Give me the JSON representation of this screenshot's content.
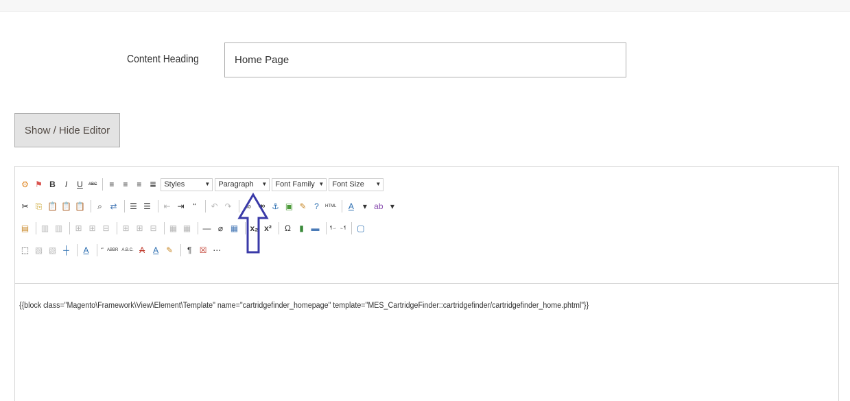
{
  "content_heading": {
    "label": "Content Heading",
    "value": "Home Page"
  },
  "editor_toggle": {
    "label": "Show / Hide Editor"
  },
  "toolbar": {
    "row1": [
      {
        "type": "icon",
        "name": "magento-widget-icon",
        "glyph": "⚙",
        "color": "#e08a2b"
      },
      {
        "type": "icon",
        "name": "magento-variable-icon",
        "glyph": "⚑",
        "color": "#d9534f"
      },
      {
        "type": "icon",
        "name": "bold-icon",
        "glyph": "B",
        "bold": true
      },
      {
        "type": "icon",
        "name": "italic-icon",
        "glyph": "I",
        "italic": true
      },
      {
        "type": "icon",
        "name": "underline-icon",
        "glyph": "U",
        "underline": true
      },
      {
        "type": "icon",
        "name": "strikethrough-icon",
        "glyph": "ABC",
        "small": true,
        "strike": true
      },
      {
        "type": "sep"
      },
      {
        "type": "icon",
        "name": "align-left-icon",
        "glyph": "≡"
      },
      {
        "type": "icon",
        "name": "align-center-icon",
        "glyph": "≡"
      },
      {
        "type": "icon",
        "name": "align-right-icon",
        "glyph": "≡"
      },
      {
        "type": "icon",
        "name": "align-justify-icon",
        "glyph": "≣"
      },
      {
        "type": "dropdown",
        "name": "styles-dropdown",
        "label": "Styles",
        "width": 76
      },
      {
        "type": "dropdown",
        "name": "paragraph-dropdown",
        "label": "Paragraph",
        "width": 80
      },
      {
        "type": "dropdown",
        "name": "font-family-dropdown",
        "label": "Font Family",
        "width": 80
      },
      {
        "type": "dropdown",
        "name": "font-size-dropdown",
        "label": "Font Size",
        "width": 80
      }
    ],
    "row2": [
      {
        "type": "icon",
        "name": "cut-icon",
        "glyph": "✂"
      },
      {
        "type": "icon",
        "name": "copy-icon",
        "glyph": "⎘",
        "color": "#c9a227"
      },
      {
        "type": "icon",
        "name": "paste-icon",
        "glyph": "📋"
      },
      {
        "type": "icon",
        "name": "paste-text-icon",
        "glyph": "📋"
      },
      {
        "type": "icon",
        "name": "paste-word-icon",
        "glyph": "📋"
      },
      {
        "type": "sep"
      },
      {
        "type": "icon",
        "name": "find-icon",
        "glyph": "⌕"
      },
      {
        "type": "icon",
        "name": "replace-icon",
        "glyph": "⇄",
        "color": "#4a7bb7"
      },
      {
        "type": "sep"
      },
      {
        "type": "icon",
        "name": "bullet-list-icon",
        "glyph": "☰"
      },
      {
        "type": "icon",
        "name": "numbered-list-icon",
        "glyph": "☰"
      },
      {
        "type": "sep"
      },
      {
        "type": "icon",
        "name": "outdent-icon",
        "glyph": "⇤",
        "dim": true
      },
      {
        "type": "icon",
        "name": "indent-icon",
        "glyph": "⇥"
      },
      {
        "type": "icon",
        "name": "blockquote-icon",
        "glyph": "“"
      },
      {
        "type": "sep"
      },
      {
        "type": "icon",
        "name": "undo-icon",
        "glyph": "↶",
        "dim": true
      },
      {
        "type": "icon",
        "name": "redo-icon",
        "glyph": "↷",
        "dim": true
      },
      {
        "type": "sep"
      },
      {
        "type": "icon",
        "name": "link-icon",
        "glyph": "∞"
      },
      {
        "type": "icon",
        "name": "unlink-icon",
        "glyph": "⚮"
      },
      {
        "type": "icon",
        "name": "anchor-icon",
        "glyph": "⚓",
        "color": "#2a6db0"
      },
      {
        "type": "icon",
        "name": "image-icon",
        "glyph": "▣",
        "color": "#4c9a3a"
      },
      {
        "type": "icon",
        "name": "cleanup-icon",
        "glyph": "✎",
        "color": "#c98a2b"
      },
      {
        "type": "icon",
        "name": "help-icon",
        "glyph": "?",
        "color": "#2a6db0"
      },
      {
        "type": "icon",
        "name": "html-source-icon",
        "glyph": "HTML",
        "small": true
      },
      {
        "type": "sep"
      },
      {
        "type": "icon",
        "name": "text-color-icon",
        "glyph": "A",
        "underline": true,
        "color": "#2a6db0"
      },
      {
        "type": "icon",
        "name": "text-color-dropdown-icon",
        "glyph": "▾"
      },
      {
        "type": "icon",
        "name": "background-color-icon",
        "glyph": "ab",
        "color": "#8a4fb0"
      },
      {
        "type": "icon",
        "name": "background-color-dropdown-icon",
        "glyph": "▾"
      }
    ],
    "row3": [
      {
        "type": "icon",
        "name": "table-insert-icon",
        "glyph": "▤",
        "color": "#c98a2b"
      },
      {
        "type": "sep"
      },
      {
        "type": "icon",
        "name": "row-props-icon",
        "glyph": "▥",
        "dim": true
      },
      {
        "type": "icon",
        "name": "cell-props-icon",
        "glyph": "▥",
        "dim": true
      },
      {
        "type": "sep"
      },
      {
        "type": "icon",
        "name": "insert-row-before-icon",
        "glyph": "⊞",
        "dim": true
      },
      {
        "type": "icon",
        "name": "insert-row-after-icon",
        "glyph": "⊞",
        "dim": true
      },
      {
        "type": "icon",
        "name": "delete-row-icon",
        "glyph": "⊟",
        "dim": true
      },
      {
        "type": "sep"
      },
      {
        "type": "icon",
        "name": "insert-col-before-icon",
        "glyph": "⊞",
        "dim": true
      },
      {
        "type": "icon",
        "name": "insert-col-after-icon",
        "glyph": "⊞",
        "dim": true
      },
      {
        "type": "icon",
        "name": "delete-col-icon",
        "glyph": "⊟",
        "dim": true
      },
      {
        "type": "sep"
      },
      {
        "type": "icon",
        "name": "split-cells-icon",
        "glyph": "▦",
        "dim": true
      },
      {
        "type": "icon",
        "name": "merge-cells-icon",
        "glyph": "▦",
        "dim": true
      },
      {
        "type": "sep"
      },
      {
        "type": "icon",
        "name": "horizontal-rule-icon",
        "glyph": "—"
      },
      {
        "type": "icon",
        "name": "remove-format-icon",
        "glyph": "⌀"
      },
      {
        "type": "icon",
        "name": "visual-aid-icon",
        "glyph": "▦",
        "color": "#4a7bb7"
      },
      {
        "type": "sep"
      },
      {
        "type": "icon",
        "name": "subscript-icon",
        "glyph": "x₂",
        "bold": true
      },
      {
        "type": "icon",
        "name": "superscript-icon",
        "glyph": "x²",
        "bold": true
      },
      {
        "type": "sep"
      },
      {
        "type": "icon",
        "name": "special-char-icon",
        "glyph": "Ω"
      },
      {
        "type": "icon",
        "name": "media-icon",
        "glyph": "▮",
        "color": "#3a8a3a"
      },
      {
        "type": "icon",
        "name": "separator-icon",
        "glyph": "▬",
        "color": "#4a7bb7"
      },
      {
        "type": "sep"
      },
      {
        "type": "icon",
        "name": "ltr-icon",
        "glyph": "¶→",
        "small": true
      },
      {
        "type": "icon",
        "name": "rtl-icon",
        "glyph": "←¶",
        "small": true
      },
      {
        "type": "sep"
      },
      {
        "type": "icon",
        "name": "fullscreen-icon",
        "glyph": "▢",
        "color": "#2a6db0"
      }
    ],
    "row4": [
      {
        "type": "icon",
        "name": "insert-layer-icon",
        "glyph": "⬚"
      },
      {
        "type": "icon",
        "name": "move-forward-icon",
        "glyph": "▧",
        "dim": true
      },
      {
        "type": "icon",
        "name": "move-backward-icon",
        "glyph": "▧",
        "dim": true
      },
      {
        "type": "icon",
        "name": "absolute-icon",
        "glyph": "┼",
        "color": "#2a6db0"
      },
      {
        "type": "sep"
      },
      {
        "type": "icon",
        "name": "style-props-icon",
        "glyph": "A",
        "underline": true,
        "color": "#2a6db0"
      },
      {
        "type": "sep"
      },
      {
        "type": "icon",
        "name": "cite-icon",
        "glyph": "“”",
        "small": true
      },
      {
        "type": "icon",
        "name": "abbreviation-icon",
        "glyph": "ABBR",
        "small": true
      },
      {
        "type": "icon",
        "name": "acronym-icon",
        "glyph": "A.B.C.",
        "small": true
      },
      {
        "type": "icon",
        "name": "deletion-icon",
        "glyph": "A",
        "strike": true,
        "color": "#c0392b"
      },
      {
        "type": "icon",
        "name": "insertion-icon",
        "glyph": "A",
        "underline": true,
        "color": "#2a6db0"
      },
      {
        "type": "icon",
        "name": "attributes-icon",
        "glyph": "✎",
        "color": "#c98a2b"
      },
      {
        "type": "sep"
      },
      {
        "type": "icon",
        "name": "show-blocks-icon",
        "glyph": "¶"
      },
      {
        "type": "icon",
        "name": "nonbreaking-icon",
        "glyph": "☒",
        "color": "#c0392b"
      },
      {
        "type": "icon",
        "name": "page-break-icon",
        "glyph": "⋯"
      }
    ]
  },
  "editor_content": "{{block class=\"Magento\\Framework\\View\\Element\\Template\" name=\"cartridgefinder_homepage\" template=\"MES_CartridgeFinder::cartridgefinder/cartridgefinder_home.phtml\"}}",
  "colors": {
    "arrow": "#3a3aa8"
  },
  "annotation": {
    "arrow_icon": "up-arrow-annotation-icon"
  }
}
